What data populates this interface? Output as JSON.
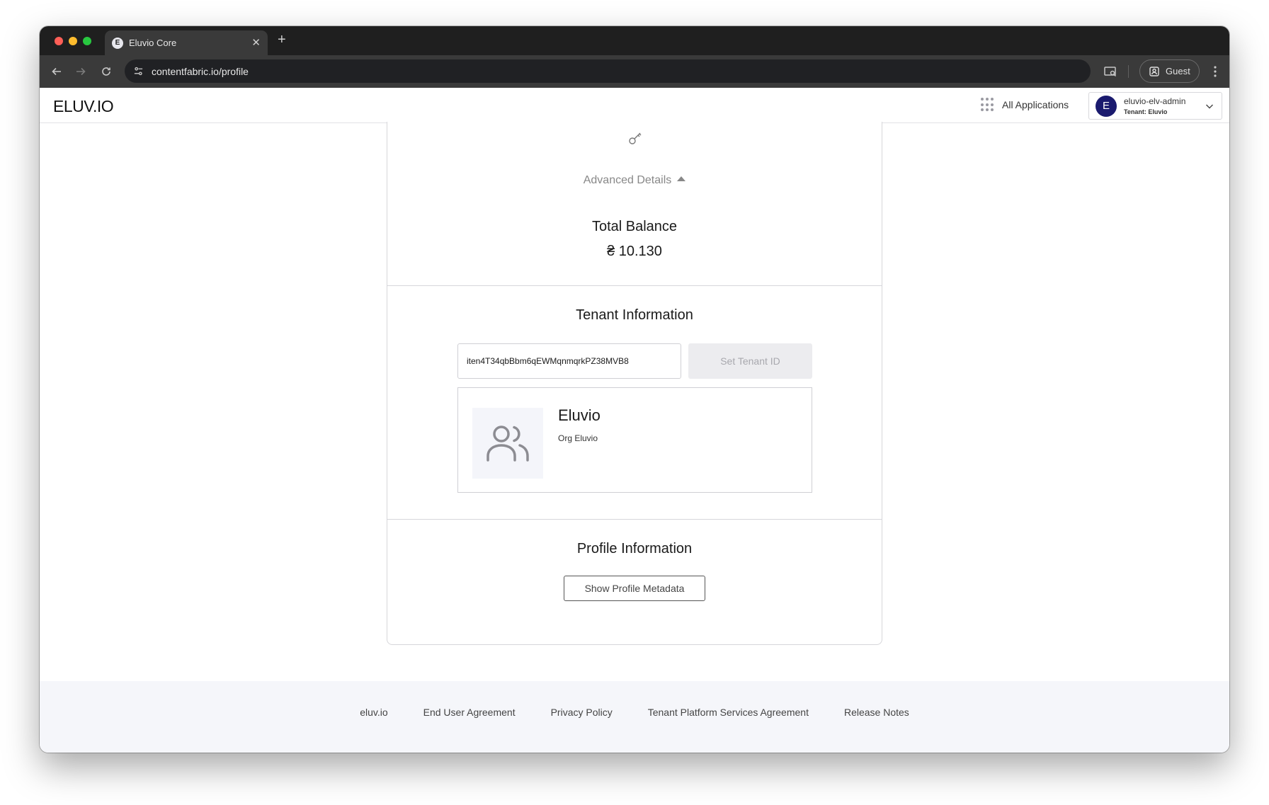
{
  "browser": {
    "tab_title": "Eluvio Core",
    "tab_favicon_letter": "E",
    "url": "contentfabric.io/profile",
    "profile_label": "Guest"
  },
  "header": {
    "logo": "ELUV.IO",
    "all_applications": "All Applications",
    "user": {
      "avatar_letter": "E",
      "name": "eluvio-elv-admin",
      "tenant": "Tenant: Eluvio"
    }
  },
  "wallet": {
    "advanced_details": "Advanced Details",
    "total_balance_label": "Total Balance",
    "balance_symbol": "₴",
    "balance_value": "10.130"
  },
  "tenant_section": {
    "title": "Tenant Information",
    "tenant_id_value": "iten4T34qbBbm6qEWMqnmqrkPZ38MVB8",
    "set_button": "Set Tenant ID",
    "tenant_name": "Eluvio",
    "tenant_description": "Org Eluvio"
  },
  "profile_section": {
    "title": "Profile Information",
    "show_metadata_button": "Show Profile Metadata"
  },
  "footer": {
    "links": [
      "eluv.io",
      "End User Agreement",
      "Privacy Policy",
      "Tenant Platform Services Agreement",
      "Release Notes"
    ]
  }
}
